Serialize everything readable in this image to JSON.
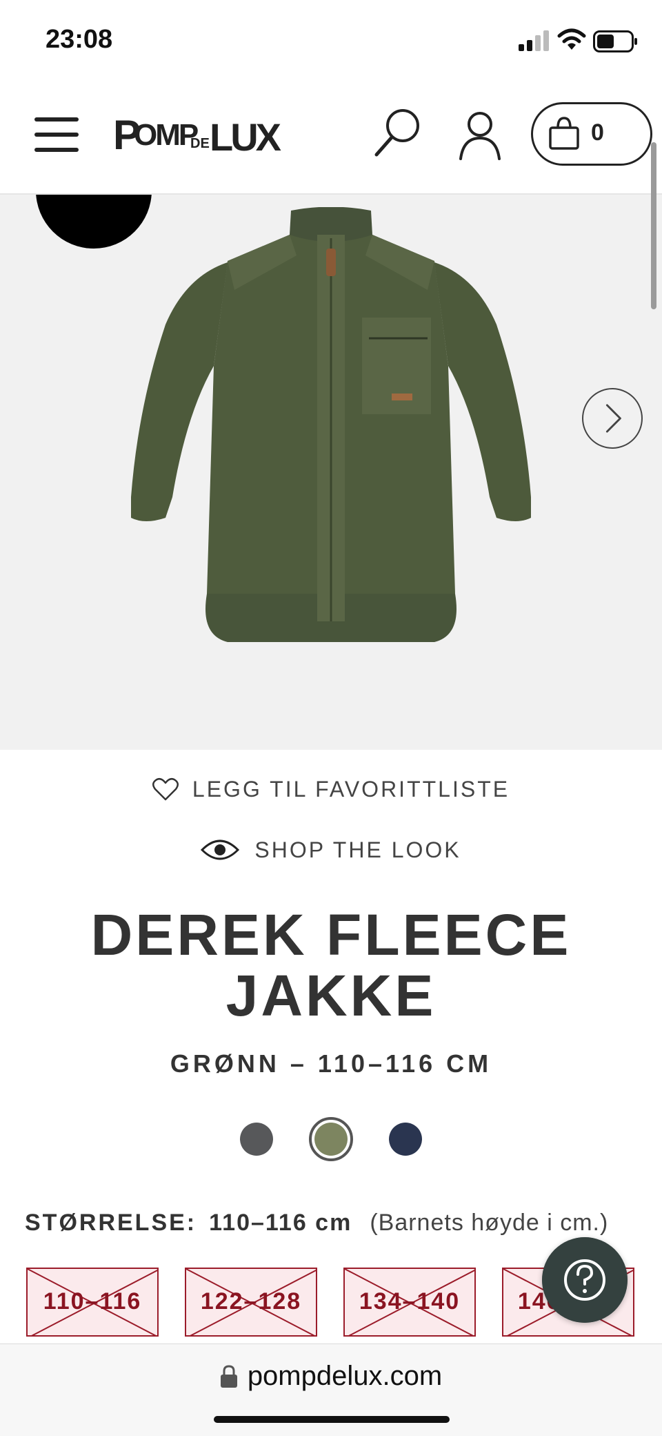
{
  "status_bar": {
    "time": "23:08"
  },
  "header": {
    "logo_text": "POMPDELUX",
    "cart_count": "0"
  },
  "favorite": {
    "label": "LEGG TIL FAVORITTLISTE"
  },
  "shop_the_look": {
    "label": "SHOP THE LOOK"
  },
  "product": {
    "title": "DEREK FLEECE JAKKE",
    "variant": "GRØNN – 110–116 CM",
    "colors": [
      {
        "name": "grey",
        "hex": "#57585a",
        "selected": false
      },
      {
        "name": "green",
        "hex": "#7d8560",
        "selected": true
      },
      {
        "name": "navy",
        "hex": "#2a3550",
        "selected": false
      }
    ]
  },
  "size": {
    "label": "STØRRELSE:",
    "value": "110–116 cm",
    "note": "(Barnets høyde i cm.)",
    "options": [
      {
        "label": "110–116",
        "available": false
      },
      {
        "label": "122–128",
        "available": false
      },
      {
        "label": "134–140",
        "available": false
      },
      {
        "label": "146–152",
        "available": false
      }
    ]
  },
  "browser": {
    "url": "pompdelux.com"
  },
  "colors": {
    "accent_red": "#9b1c2a",
    "jacket_green": "#4e5a3c",
    "help_button": "#34413f"
  }
}
